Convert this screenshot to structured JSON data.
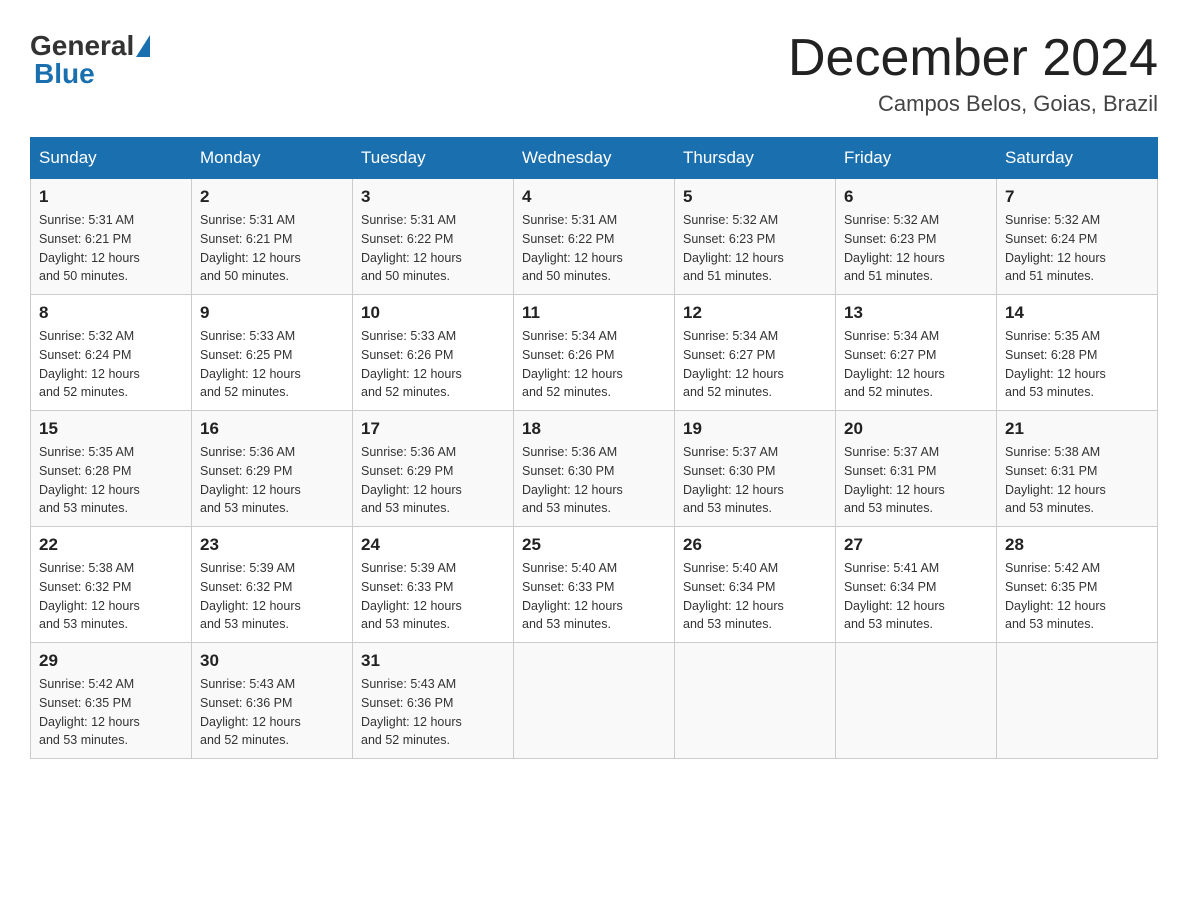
{
  "header": {
    "logo_general": "General",
    "logo_blue": "Blue",
    "month_title": "December 2024",
    "location": "Campos Belos, Goias, Brazil"
  },
  "days_of_week": [
    "Sunday",
    "Monday",
    "Tuesday",
    "Wednesday",
    "Thursday",
    "Friday",
    "Saturday"
  ],
  "weeks": [
    [
      {
        "day": "1",
        "sunrise": "5:31 AM",
        "sunset": "6:21 PM",
        "daylight": "12 hours and 50 minutes."
      },
      {
        "day": "2",
        "sunrise": "5:31 AM",
        "sunset": "6:21 PM",
        "daylight": "12 hours and 50 minutes."
      },
      {
        "day": "3",
        "sunrise": "5:31 AM",
        "sunset": "6:22 PM",
        "daylight": "12 hours and 50 minutes."
      },
      {
        "day": "4",
        "sunrise": "5:31 AM",
        "sunset": "6:22 PM",
        "daylight": "12 hours and 50 minutes."
      },
      {
        "day": "5",
        "sunrise": "5:32 AM",
        "sunset": "6:23 PM",
        "daylight": "12 hours and 51 minutes."
      },
      {
        "day": "6",
        "sunrise": "5:32 AM",
        "sunset": "6:23 PM",
        "daylight": "12 hours and 51 minutes."
      },
      {
        "day": "7",
        "sunrise": "5:32 AM",
        "sunset": "6:24 PM",
        "daylight": "12 hours and 51 minutes."
      }
    ],
    [
      {
        "day": "8",
        "sunrise": "5:32 AM",
        "sunset": "6:24 PM",
        "daylight": "12 hours and 52 minutes."
      },
      {
        "day": "9",
        "sunrise": "5:33 AM",
        "sunset": "6:25 PM",
        "daylight": "12 hours and 52 minutes."
      },
      {
        "day": "10",
        "sunrise": "5:33 AM",
        "sunset": "6:26 PM",
        "daylight": "12 hours and 52 minutes."
      },
      {
        "day": "11",
        "sunrise": "5:34 AM",
        "sunset": "6:26 PM",
        "daylight": "12 hours and 52 minutes."
      },
      {
        "day": "12",
        "sunrise": "5:34 AM",
        "sunset": "6:27 PM",
        "daylight": "12 hours and 52 minutes."
      },
      {
        "day": "13",
        "sunrise": "5:34 AM",
        "sunset": "6:27 PM",
        "daylight": "12 hours and 52 minutes."
      },
      {
        "day": "14",
        "sunrise": "5:35 AM",
        "sunset": "6:28 PM",
        "daylight": "12 hours and 53 minutes."
      }
    ],
    [
      {
        "day": "15",
        "sunrise": "5:35 AM",
        "sunset": "6:28 PM",
        "daylight": "12 hours and 53 minutes."
      },
      {
        "day": "16",
        "sunrise": "5:36 AM",
        "sunset": "6:29 PM",
        "daylight": "12 hours and 53 minutes."
      },
      {
        "day": "17",
        "sunrise": "5:36 AM",
        "sunset": "6:29 PM",
        "daylight": "12 hours and 53 minutes."
      },
      {
        "day": "18",
        "sunrise": "5:36 AM",
        "sunset": "6:30 PM",
        "daylight": "12 hours and 53 minutes."
      },
      {
        "day": "19",
        "sunrise": "5:37 AM",
        "sunset": "6:30 PM",
        "daylight": "12 hours and 53 minutes."
      },
      {
        "day": "20",
        "sunrise": "5:37 AM",
        "sunset": "6:31 PM",
        "daylight": "12 hours and 53 minutes."
      },
      {
        "day": "21",
        "sunrise": "5:38 AM",
        "sunset": "6:31 PM",
        "daylight": "12 hours and 53 minutes."
      }
    ],
    [
      {
        "day": "22",
        "sunrise": "5:38 AM",
        "sunset": "6:32 PM",
        "daylight": "12 hours and 53 minutes."
      },
      {
        "day": "23",
        "sunrise": "5:39 AM",
        "sunset": "6:32 PM",
        "daylight": "12 hours and 53 minutes."
      },
      {
        "day": "24",
        "sunrise": "5:39 AM",
        "sunset": "6:33 PM",
        "daylight": "12 hours and 53 minutes."
      },
      {
        "day": "25",
        "sunrise": "5:40 AM",
        "sunset": "6:33 PM",
        "daylight": "12 hours and 53 minutes."
      },
      {
        "day": "26",
        "sunrise": "5:40 AM",
        "sunset": "6:34 PM",
        "daylight": "12 hours and 53 minutes."
      },
      {
        "day": "27",
        "sunrise": "5:41 AM",
        "sunset": "6:34 PM",
        "daylight": "12 hours and 53 minutes."
      },
      {
        "day": "28",
        "sunrise": "5:42 AM",
        "sunset": "6:35 PM",
        "daylight": "12 hours and 53 minutes."
      }
    ],
    [
      {
        "day": "29",
        "sunrise": "5:42 AM",
        "sunset": "6:35 PM",
        "daylight": "12 hours and 53 minutes."
      },
      {
        "day": "30",
        "sunrise": "5:43 AM",
        "sunset": "6:36 PM",
        "daylight": "12 hours and 52 minutes."
      },
      {
        "day": "31",
        "sunrise": "5:43 AM",
        "sunset": "6:36 PM",
        "daylight": "12 hours and 52 minutes."
      },
      null,
      null,
      null,
      null
    ]
  ],
  "labels": {
    "sunrise": "Sunrise:",
    "sunset": "Sunset:",
    "daylight": "Daylight:"
  }
}
